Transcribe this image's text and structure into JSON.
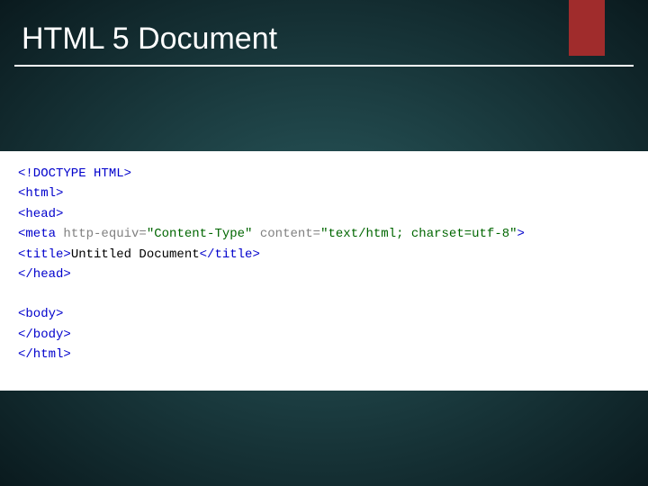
{
  "slide": {
    "title": "HTML 5 Document"
  },
  "code": {
    "lines": [
      {
        "parts": [
          {
            "cls": "tag",
            "txt": "<!DOCTYPE HTML>"
          }
        ]
      },
      {
        "parts": [
          {
            "cls": "tag",
            "txt": "<html>"
          }
        ]
      },
      {
        "parts": [
          {
            "cls": "tag",
            "txt": "<head>"
          }
        ]
      },
      {
        "parts": [
          {
            "cls": "tag",
            "txt": "<meta "
          },
          {
            "cls": "attr-name",
            "txt": "http-equiv="
          },
          {
            "cls": "attr-val",
            "txt": "\"Content-Type\""
          },
          {
            "cls": "attr-name",
            "txt": " content="
          },
          {
            "cls": "attr-val",
            "txt": "\"text/html; charset=utf-8\""
          },
          {
            "cls": "tag",
            "txt": ">"
          }
        ]
      },
      {
        "parts": [
          {
            "cls": "tag",
            "txt": "<title>"
          },
          {
            "cls": "",
            "txt": "Untitled Document"
          },
          {
            "cls": "tag",
            "txt": "</title>"
          }
        ]
      },
      {
        "parts": [
          {
            "cls": "tag",
            "txt": "</head>"
          }
        ]
      },
      {
        "spacer": true
      },
      {
        "parts": [
          {
            "cls": "tag",
            "txt": "<body>"
          }
        ]
      },
      {
        "parts": [
          {
            "cls": "tag",
            "txt": "</body>"
          }
        ]
      },
      {
        "parts": [
          {
            "cls": "tag",
            "txt": "</html>"
          }
        ]
      }
    ]
  }
}
